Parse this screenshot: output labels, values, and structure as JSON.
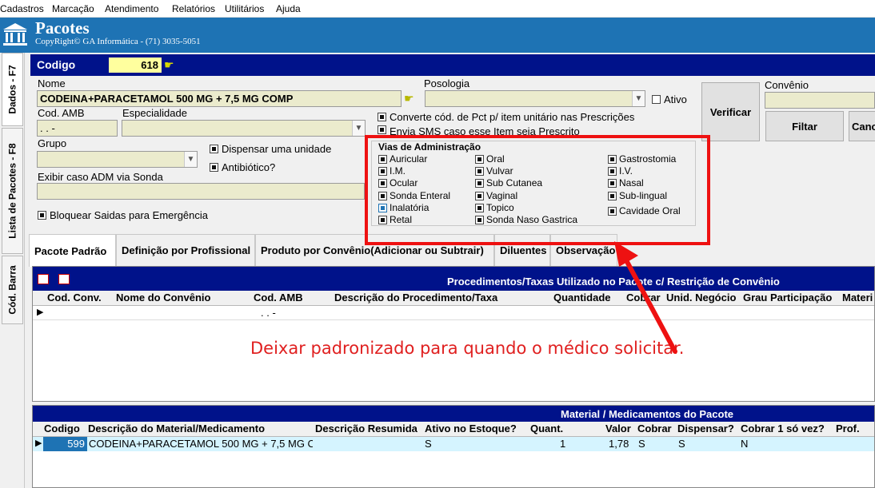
{
  "menu": [
    "Cadastros",
    "Marcação",
    "Atendimento",
    "Relatórios",
    "Utilitários",
    "Ajuda"
  ],
  "window": {
    "title": "Pacotes",
    "copyright": "CopyRight© GA Informática - (71) 3035-5051"
  },
  "side_tabs": [
    "Dados - F7",
    "Lista de Pacotes - F8",
    "Cód. Barra"
  ],
  "codigo": {
    "label": "Codigo",
    "value": "618"
  },
  "form": {
    "nome_label": "Nome",
    "nome_value": "CODEINA+PARACETAMOL 500 MG + 7,5 MG COMP",
    "posologia_label": "Posologia",
    "ativo_label": "Ativo",
    "cod_amb_label": "Cod. AMB",
    "cod_amb_value": ". .  -",
    "especialidade_label": "Especialidade",
    "grupo_label": "Grupo",
    "exibir_label": "Exibir caso ADM via Sonda",
    "dispensar_label": "Dispensar uma unidade",
    "antibiotico_label": "Antibiótico?",
    "bloquear_label": "Bloquear Saidas para Emergência",
    "converte_label": "Converte cód. de Pct p/ item unitário nas Prescrições",
    "envia_label": "Envia SMS caso esse Item seja Prescrito",
    "convenio_label": "Convênio",
    "verificar_label": "Verificar",
    "filtar_label": "Filtar",
    "cancel_label": "Canc"
  },
  "vias": {
    "title": "Vias de Administração",
    "items": [
      {
        "label": "Auricular",
        "checked": true
      },
      {
        "label": "Oral",
        "checked": true
      },
      {
        "label": "Gastrostomia",
        "checked": true
      },
      {
        "label": "I.M.",
        "checked": true
      },
      {
        "label": "Vulvar",
        "checked": true
      },
      {
        "label": "I.V.",
        "checked": true
      },
      {
        "label": "Ocular",
        "checked": true
      },
      {
        "label": "Sub Cutanea",
        "checked": true
      },
      {
        "label": "Nasal",
        "checked": true
      },
      {
        "label": "Sonda Enteral",
        "checked": true
      },
      {
        "label": "Vaginal",
        "checked": true
      },
      {
        "label": "Sub-lingual",
        "checked": true
      },
      {
        "label": "Inalatória",
        "checked": true
      },
      {
        "label": "Topico",
        "checked": true
      },
      {
        "label": "Cavidade Oral",
        "checked": true
      },
      {
        "label": "Retal",
        "checked": true
      },
      {
        "label": "Sonda Naso Gastrica",
        "checked": true
      }
    ]
  },
  "tabs": [
    "Pacote Padrão",
    "Definição por Profissional",
    "Produto por Convênio(Adicionar  ou Subtrair)",
    "Diluentes",
    "Observação"
  ],
  "grid1": {
    "title": "Procedimentos/Taxas Utilizado no Pacote c/ Restrição de Convênio",
    "columns": [
      "Cod. Conv.",
      "Nome do Convênio",
      "Cod. AMB",
      "Descrição do Procedimento/Taxa",
      "Quantidade",
      "Cobrar",
      "Unid. Negócio",
      "Grau Participação",
      "Materi"
    ],
    "row_amb": ". .  -"
  },
  "annotation": "Deixar padronizado para quando o médico solicitar.",
  "grid2": {
    "title": "Material / Medicamentos do Pacote",
    "columns": [
      "Codigo",
      "Descrição do Material/Medicamento",
      "Descrição Resumida",
      "Ativo no Estoque?",
      "Quant.",
      "Valor",
      "Cobrar",
      "Dispensar?",
      "Cobrar 1 só vez?",
      "Prof."
    ],
    "row": [
      "599",
      "CODEINA+PARACETAMOL 500 MG + 7,5 MG C",
      "",
      "S",
      "1",
      "1,78",
      "S",
      "S",
      "N",
      ""
    ]
  },
  "colors": {
    "title_bar": "#1e73b4",
    "header_bar": "#00128a",
    "field_bg": "#ebebcd",
    "annotation": "#ee1111"
  }
}
